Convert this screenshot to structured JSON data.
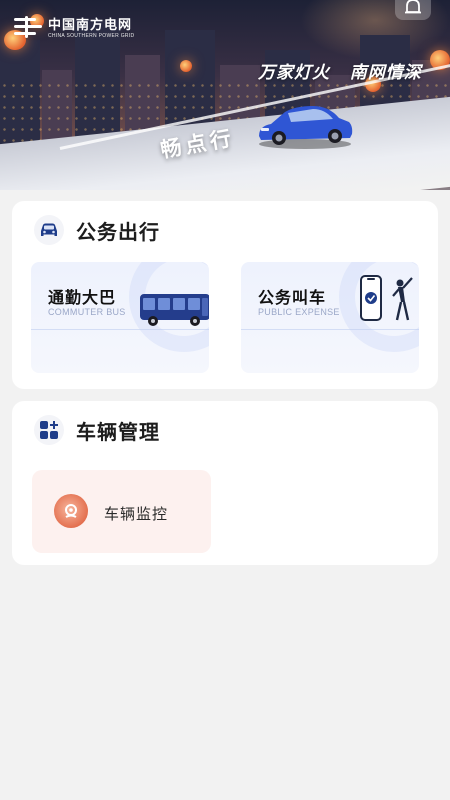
{
  "header": {
    "logo": {
      "cn": "中国南方电网",
      "en": "CHINA SOUTHERN POWER GRID"
    },
    "slogan": [
      "万家灯火",
      "南网情深"
    ],
    "road_text": "畅点行"
  },
  "sections": [
    {
      "title": "公务出行",
      "icon": "car-icon",
      "tiles": [
        {
          "title": "通勤大巴",
          "subtitle": "COMMUTER BUS",
          "icon": "bus-icon"
        },
        {
          "title": "公务叫车",
          "subtitle": "PUBLIC EXPENSE",
          "icon": "phone-hail-icon"
        }
      ]
    },
    {
      "title": "车辆管理",
      "icon": "grid-plus-icon",
      "tiles": [
        {
          "title": "车辆监控",
          "icon": "monitor-icon"
        }
      ]
    }
  ],
  "colors": {
    "accent": "#1f3d8a",
    "tile_blue": "#eef2fd",
    "tile_pink": "#fdf1ef",
    "background": "#f2f2f2"
  }
}
